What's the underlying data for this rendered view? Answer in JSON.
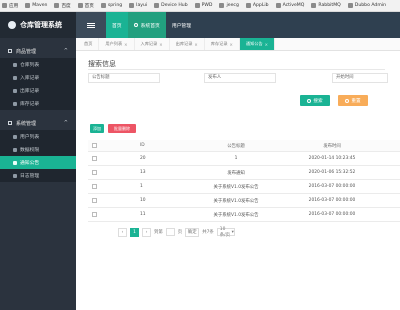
{
  "bookmarks": [
    "应用",
    "Maven",
    "百度",
    "首页",
    "spring",
    "layui",
    "Device Hub",
    "PWD",
    "jeecg",
    "AppLib",
    "ActiveMQ",
    "RabbitMQ",
    "Dubbo Admin"
  ],
  "sidebar": {
    "brand": "仓库管理系统",
    "groups": [
      {
        "label": "商品管理",
        "items": [
          "仓库列表",
          "入库记录",
          "出库记录",
          "库存记录"
        ]
      },
      {
        "label": "系统管理",
        "items": [
          "用户列表",
          "数据权限",
          "通知公告",
          "日志管理"
        ],
        "active_index": 2
      }
    ]
  },
  "topnav": {
    "tabs": [
      "首页",
      "系统首页",
      "用户管理"
    ]
  },
  "page_tabs": [
    "首页",
    "用户列表",
    "入库记录",
    "出库记录",
    "库存记录",
    "通知公告"
  ],
  "search": {
    "title": "搜索信息",
    "fields": [
      "公告标题",
      "发布人",
      "开始时间"
    ],
    "search_button": "搜索",
    "reset_button": "重置"
  },
  "toolbar": {
    "add": "添加",
    "delete": "批量删除"
  },
  "table": {
    "headers": [
      "ID",
      "公告标题",
      "发布时间"
    ],
    "rows": [
      {
        "id": "20",
        "title": "1",
        "time": "2020-01-14 10:23:45"
      },
      {
        "id": "13",
        "title": "发布通知",
        "time": "2020-01-06 15:32:52"
      },
      {
        "id": "1",
        "title": "关于系统V1.0发布公告",
        "time": "2016-03-07 00:00:00"
      },
      {
        "id": "10",
        "title": "关于系统V1.0发布公告",
        "time": "2016-03-07 00:00:00"
      },
      {
        "id": "11",
        "title": "关于系统V1.0发布公告",
        "time": "2016-03-07 00:00:00"
      }
    ]
  },
  "pager": {
    "current": "1",
    "goto_label": "到第",
    "page_label": "页",
    "confirm": "确定",
    "total": "共7条",
    "page_size": "10 条/页"
  }
}
